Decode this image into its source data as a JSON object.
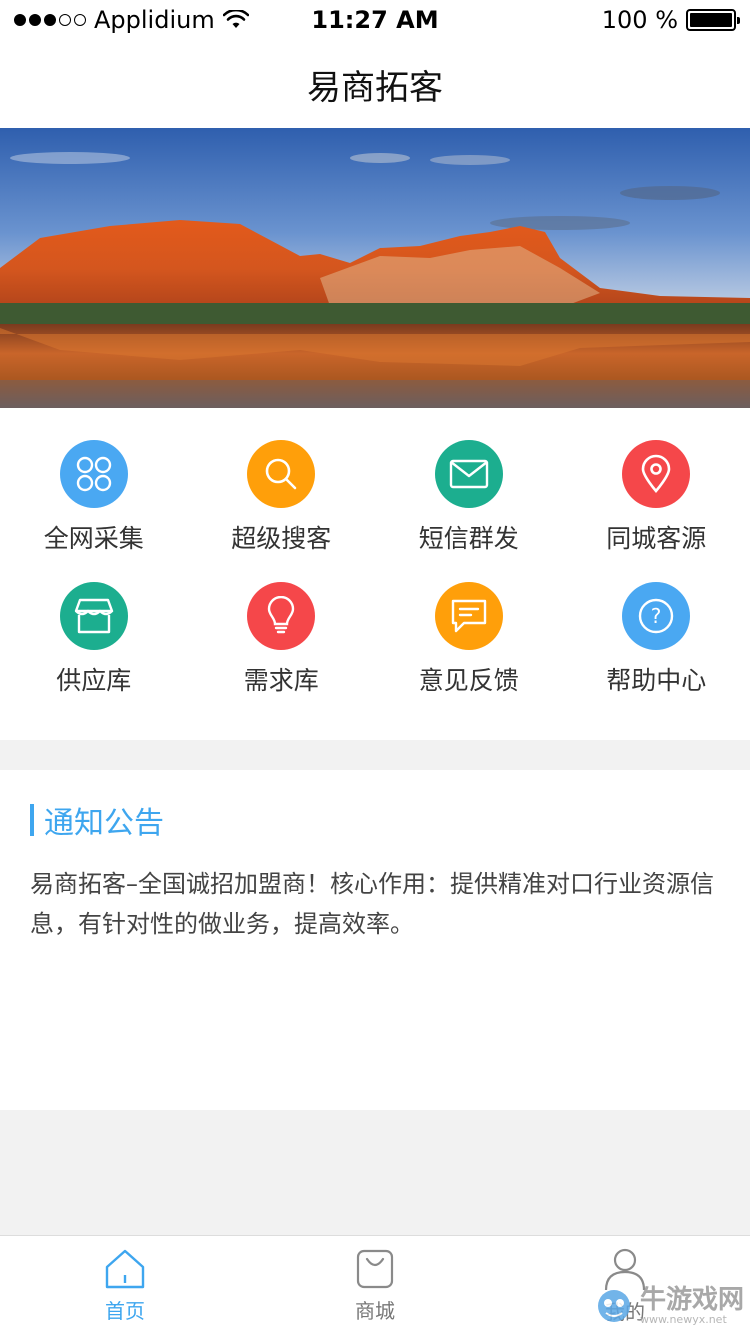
{
  "status_bar": {
    "carrier": "Applidium",
    "time": "11:27 AM",
    "battery": "100 %",
    "signal_filled": 3,
    "signal_total": 5,
    "battery_level": 1.0
  },
  "nav": {
    "title": "易商拓客"
  },
  "grid": {
    "items": [
      {
        "label": "全网采集",
        "icon": "clover-icon",
        "color": "#4aa8f2"
      },
      {
        "label": "超级搜客",
        "icon": "search-icon",
        "color": "#ff9f0a"
      },
      {
        "label": "短信群发",
        "icon": "mail-icon",
        "color": "#1cae8f"
      },
      {
        "label": "同城客源",
        "icon": "location-pin-icon",
        "color": "#f5474a"
      },
      {
        "label": "供应库",
        "icon": "store-icon",
        "color": "#1cae8f"
      },
      {
        "label": "需求库",
        "icon": "lightbulb-icon",
        "color": "#f5474a"
      },
      {
        "label": "意见反馈",
        "icon": "chat-bubble-icon",
        "color": "#ff9f0a"
      },
      {
        "label": "帮助中心",
        "icon": "help-icon",
        "color": "#4aa8f2"
      }
    ]
  },
  "notice": {
    "title": "通知公告",
    "body": "易商拓客–全国诚招加盟商！核心作用：提供精准对口行业资源信息，有针对性的做业务，提高效率。"
  },
  "tabs": [
    {
      "label": "首页",
      "icon": "home-icon",
      "active": true
    },
    {
      "label": "商城",
      "icon": "shopping-bag-icon",
      "active": false
    },
    {
      "label": "我的",
      "icon": "user-icon",
      "active": false
    }
  ],
  "watermark": {
    "text": "牛游戏网",
    "sub": "www.newyx.net"
  },
  "colors": {
    "accent": "#3ea6ef"
  }
}
